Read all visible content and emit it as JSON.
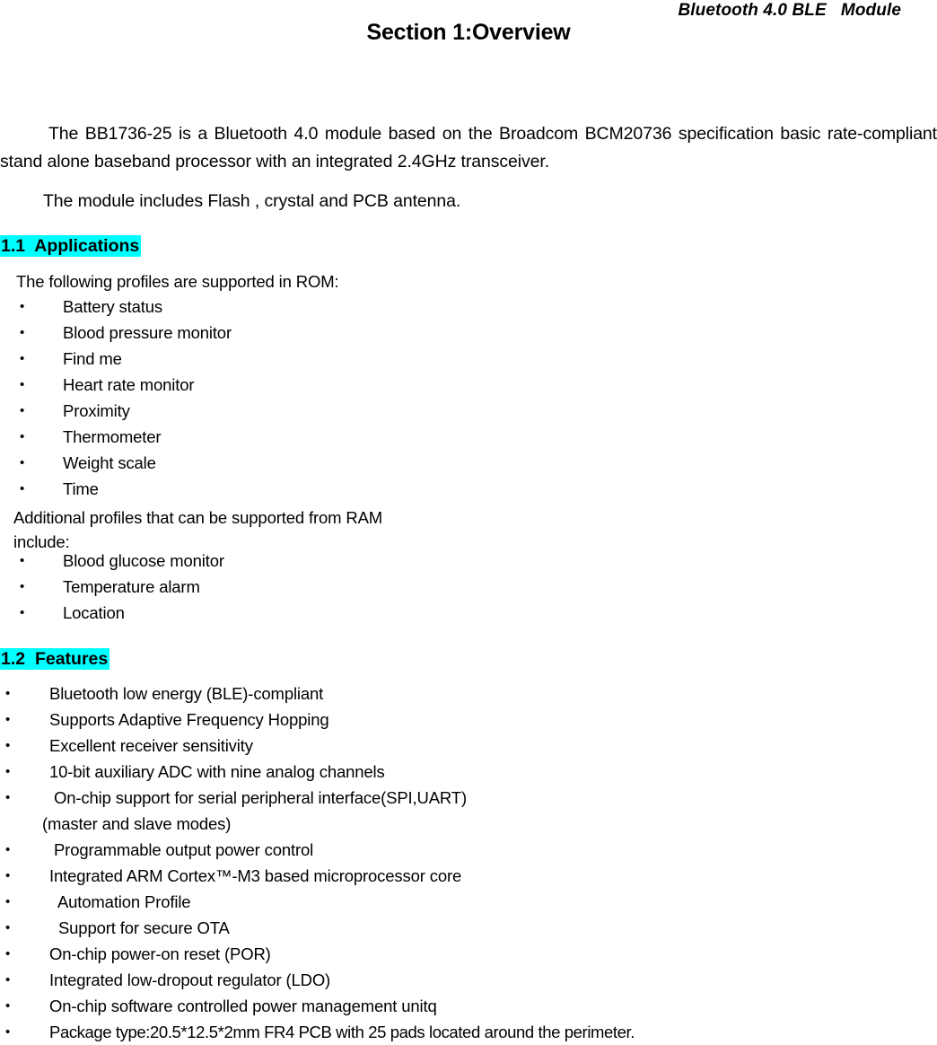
{
  "header": {
    "running_title": "Bluetooth 4.0 BLE   Module"
  },
  "title": "Section 1:Overview",
  "paragraphs": {
    "intro": "The BB1736-25 is a Bluetooth 4.0 module based on the Broadcom BCM20736 specification basic rate-compliant stand alone baseband processor with an integrated 2.4GHz transceiver.",
    "module": "The module includes Flash , crystal and PCB antenna."
  },
  "sections": [
    {
      "number": "1.1",
      "title": "Applications",
      "highlight_color": "#00FFFF",
      "lead_in_rom": "The following profiles are supported in ROM:",
      "rom_profiles": [
        "Battery status",
        "Blood pressure monitor",
        "Find me",
        "Heart rate monitor",
        "Proximity",
        "Thermometer",
        "Weight scale",
        "Time"
      ],
      "lead_in_ram": "Additional profiles that can be supported from RAM include:",
      "ram_profiles": [
        "Blood glucose monitor",
        "Temperature alarm",
        "Location"
      ]
    },
    {
      "number": "1.2",
      "title": "Features",
      "highlight_color": "#00FFFF",
      "features": [
        {
          "text": "Bluetooth low energy (BLE)-compliant"
        },
        {
          "text": "Supports Adaptive Frequency Hopping"
        },
        {
          "text": "Excellent receiver sensitivity"
        },
        {
          "text": "10-bit auxiliary ADC with nine analog channels"
        },
        {
          "text": " On-chip support for serial peripheral interface(SPI,UART)",
          "continuation": "(master and slave modes)"
        },
        {
          "text": " Programmable output power control"
        },
        {
          "text": "Integrated ARM Cortex™-M3 based microprocessor core"
        },
        {
          "text": "  Automation Profile"
        },
        {
          "text": "  Support for secure OTA"
        },
        {
          "text": "On-chip power-on reset (POR)"
        },
        {
          "text": "Integrated low-dropout regulator (LDO)"
        },
        {
          "text": "On-chip software controlled power management unitq"
        },
        {
          "text": "Package type:20.5*12.5*2mm FR4 PCB with 25 pads located around the perimeter."
        }
      ]
    }
  ],
  "bullet_glyph": "•"
}
